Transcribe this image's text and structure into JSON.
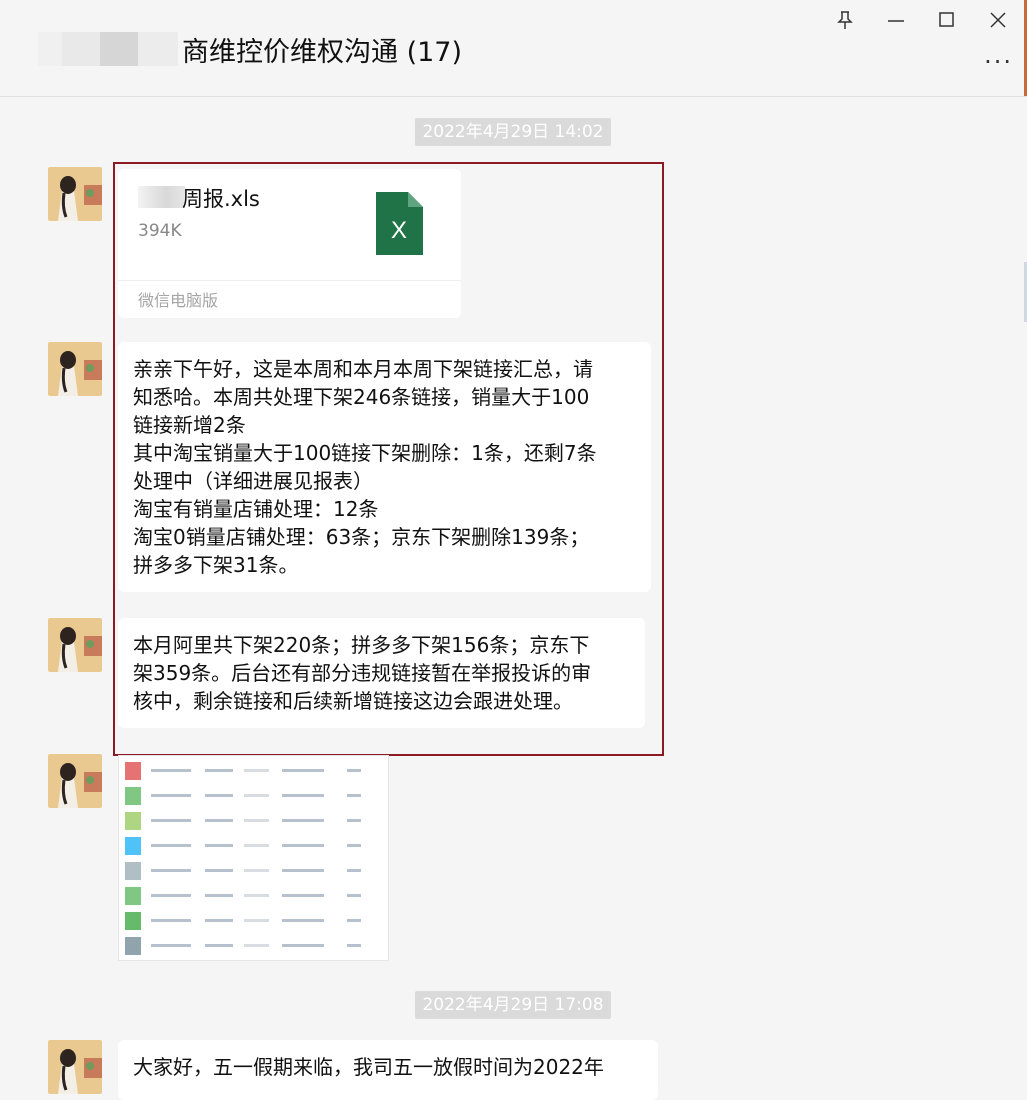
{
  "window": {
    "title": "商维控价维权沟通 (17)",
    "controls": {
      "pin": "pin-icon",
      "minimize": "minimize-icon",
      "maximize": "maximize-icon",
      "close": "close-icon",
      "more": "···"
    }
  },
  "messages": [
    {
      "type": "timestamp",
      "text": "2022年4月29日 14:02"
    },
    {
      "type": "file",
      "file_name": "周报.xls",
      "file_size": "394K",
      "file_icon": "excel-icon",
      "file_icon_label": "X",
      "source": "微信电脑版"
    },
    {
      "type": "text",
      "lines": [
        "亲亲下午好，这是本周和本月本周下架链接汇总，请",
        "知悉哈。本周共处理下架246条链接，销量大于100",
        "链接新增2条",
        "其中淘宝销量大于100链接下架删除：1条，还剩7条",
        "处理中（详细进展见报表）",
        "淘宝有销量店铺处理：12条",
        "淘宝0销量店铺处理：63条；京东下架删除139条；",
        "拼多多下架31条。"
      ]
    },
    {
      "type": "text",
      "lines": [
        "本月阿里共下架220条；拼多多下架156条；京东下",
        "架359条。后台还有部分违规链接暂在举报投诉的审",
        "核中，剩余链接和后续新增链接这边会跟进处理。"
      ]
    },
    {
      "type": "image",
      "description_icon": "spreadsheet-screenshot"
    },
    {
      "type": "timestamp",
      "text": "2022年4月29日 17:08"
    },
    {
      "type": "text",
      "lines": [
        "大家好，五一假期来临，我司五一放假时间为2022年"
      ]
    }
  ],
  "colors": {
    "background": "#f5f5f5",
    "bubble": "#ffffff",
    "highlight_border": "#8b1a24",
    "excel_green": "#1f7346",
    "timestamp_bg": "#dadada"
  }
}
